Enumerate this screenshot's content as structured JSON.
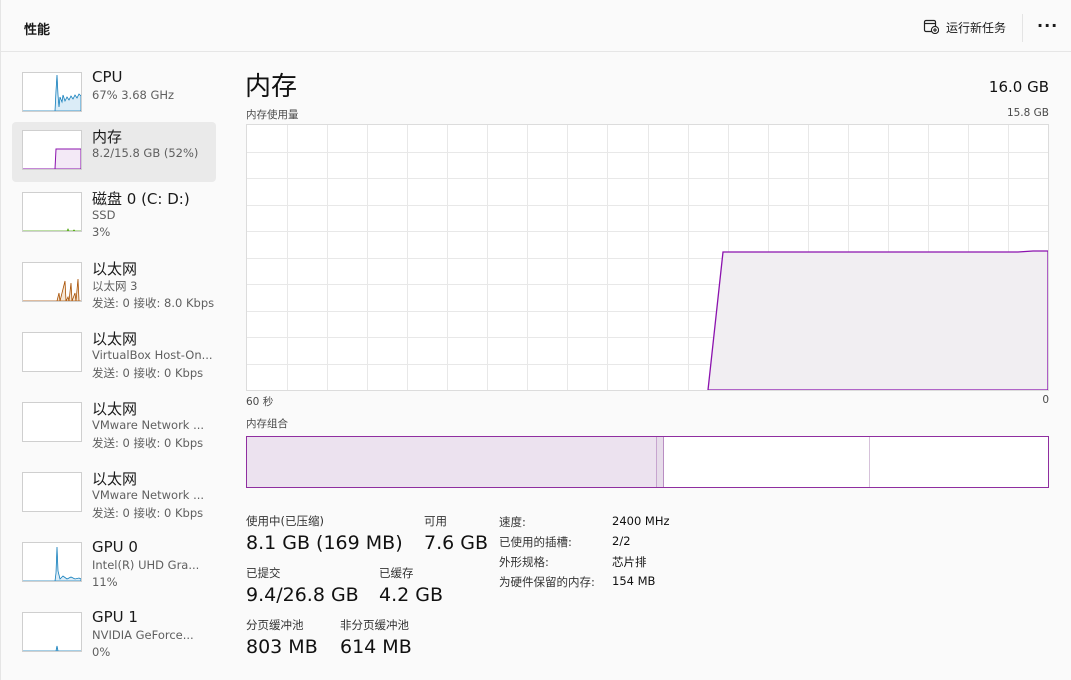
{
  "header": {
    "title": "性能",
    "run_task_label": "运行新任务",
    "more_label": "···",
    "run_task_icon": "run-task-icon",
    "more_icon": "more-icon"
  },
  "sidebar": {
    "items": [
      {
        "name": "CPU",
        "line1": "67% 3.68 GHz",
        "line2": "",
        "color": "#117dbb",
        "selected": false
      },
      {
        "name": "内存",
        "line1": "8.2/15.8 GB (52%)",
        "line2": "",
        "color": "#8b12ae",
        "selected": true
      },
      {
        "name": "磁盘 0 (C: D:)",
        "line1": "SSD",
        "line2": "3%",
        "color": "#4da60c",
        "selected": false
      },
      {
        "name": "以太网",
        "line1": "以太网 3",
        "line2": "发送: 0 接收: 8.0 Kbps",
        "color": "#a74f01",
        "selected": false
      },
      {
        "name": "以太网",
        "line1": "VirtualBox Host-On...",
        "line2": "发送: 0 接收: 0 Kbps",
        "color": "#a74f01",
        "selected": false
      },
      {
        "name": "以太网",
        "line1": "VMware Network ...",
        "line2": "发送: 0 接收: 0 Kbps",
        "color": "#a74f01",
        "selected": false
      },
      {
        "name": "以太网",
        "line1": "VMware Network ...",
        "line2": "发送: 0 接收: 0 Kbps",
        "color": "#a74f01",
        "selected": false
      },
      {
        "name": "GPU 0",
        "line1": "Intel(R) UHD Gra...",
        "line2": "11%",
        "color": "#117dbb",
        "selected": false
      },
      {
        "name": "GPU 1",
        "line1": "NVIDIA GeForce...",
        "line2": "0%",
        "color": "#117dbb",
        "selected": false
      }
    ]
  },
  "main": {
    "title": "内存",
    "total": "16.0 GB",
    "usage_label": "内存使用量",
    "usage_max": "15.8 GB",
    "axis_left": "60 秒",
    "axis_right": "0",
    "composition_label": "内存组合",
    "stats": {
      "in_use_label": "使用中(已压缩)",
      "in_use_value": "8.1 GB (169 MB)",
      "available_label": "可用",
      "available_value": "7.6 GB",
      "committed_label": "已提交",
      "committed_value": "9.4/26.8 GB",
      "cached_label": "已缓存",
      "cached_value": "4.2 GB",
      "paged_label": "分页缓冲池",
      "paged_value": "803 MB",
      "nonpaged_label": "非分页缓冲池",
      "nonpaged_value": "614 MB"
    },
    "info": [
      {
        "key": "速度:",
        "value": "2400 MHz"
      },
      {
        "key": "已使用的插槽:",
        "value": "2/2"
      },
      {
        "key": "外形规格:",
        "value": "芯片排"
      },
      {
        "key": "为硬件保留的内存:",
        "value": "154 MB"
      }
    ],
    "memory_usage_percent": 52,
    "accent_color": "#8b12ae"
  }
}
